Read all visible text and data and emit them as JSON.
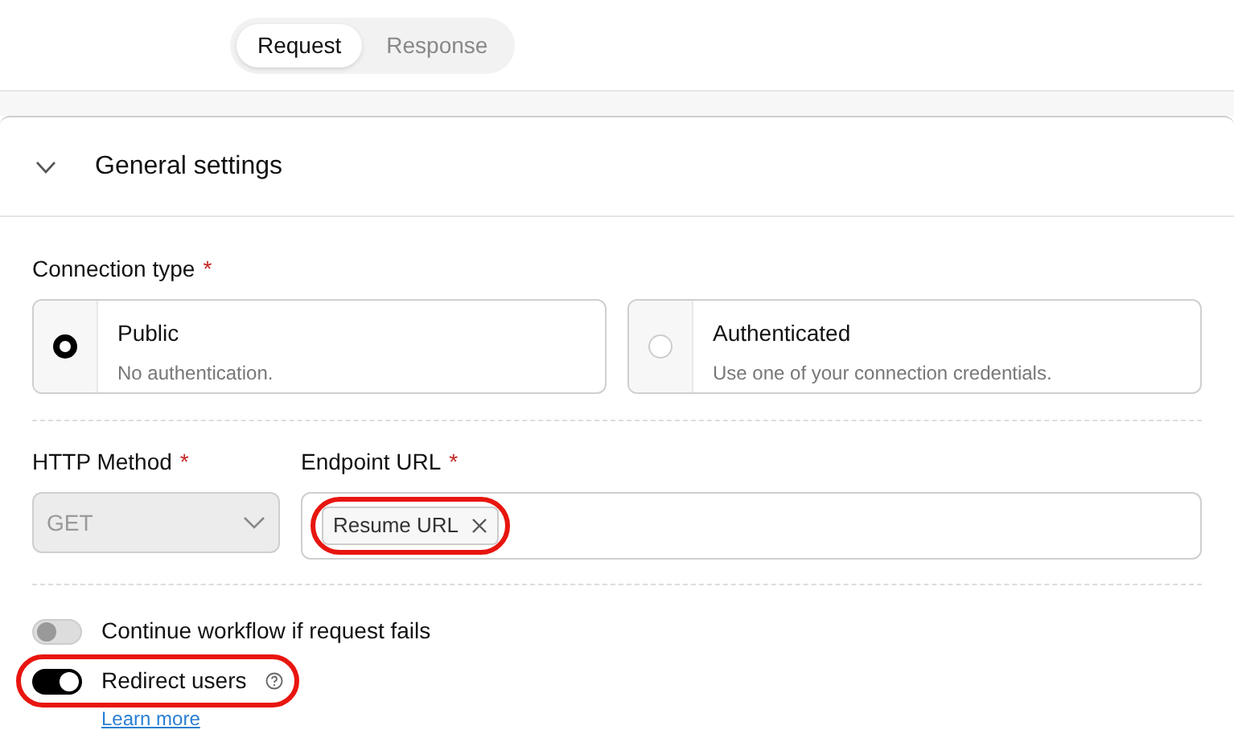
{
  "tabs": [
    {
      "label": "Request",
      "selected": true
    },
    {
      "label": "Response",
      "selected": false
    }
  ],
  "section": {
    "title": "General settings",
    "expanded": true
  },
  "connection_type": {
    "label": "Connection type",
    "required": "*",
    "options": [
      {
        "title": "Public",
        "description": "No authentication.",
        "selected": true
      },
      {
        "title": "Authenticated",
        "description": "Use one of your connection credentials.",
        "selected": false
      }
    ]
  },
  "http_method": {
    "label": "HTTP Method",
    "required": "*",
    "value": "GET",
    "disabled": true
  },
  "endpoint_url": {
    "label": "Endpoint URL",
    "required": "*",
    "tags": [
      {
        "label": "Resume URL",
        "highlighted": true
      }
    ]
  },
  "toggles": [
    {
      "label": "Continue workflow if request fails",
      "on": false,
      "highlighted": false,
      "help": false
    },
    {
      "label": "Redirect users",
      "on": true,
      "highlighted": true,
      "help": true,
      "link": "Learn more"
    }
  ]
}
